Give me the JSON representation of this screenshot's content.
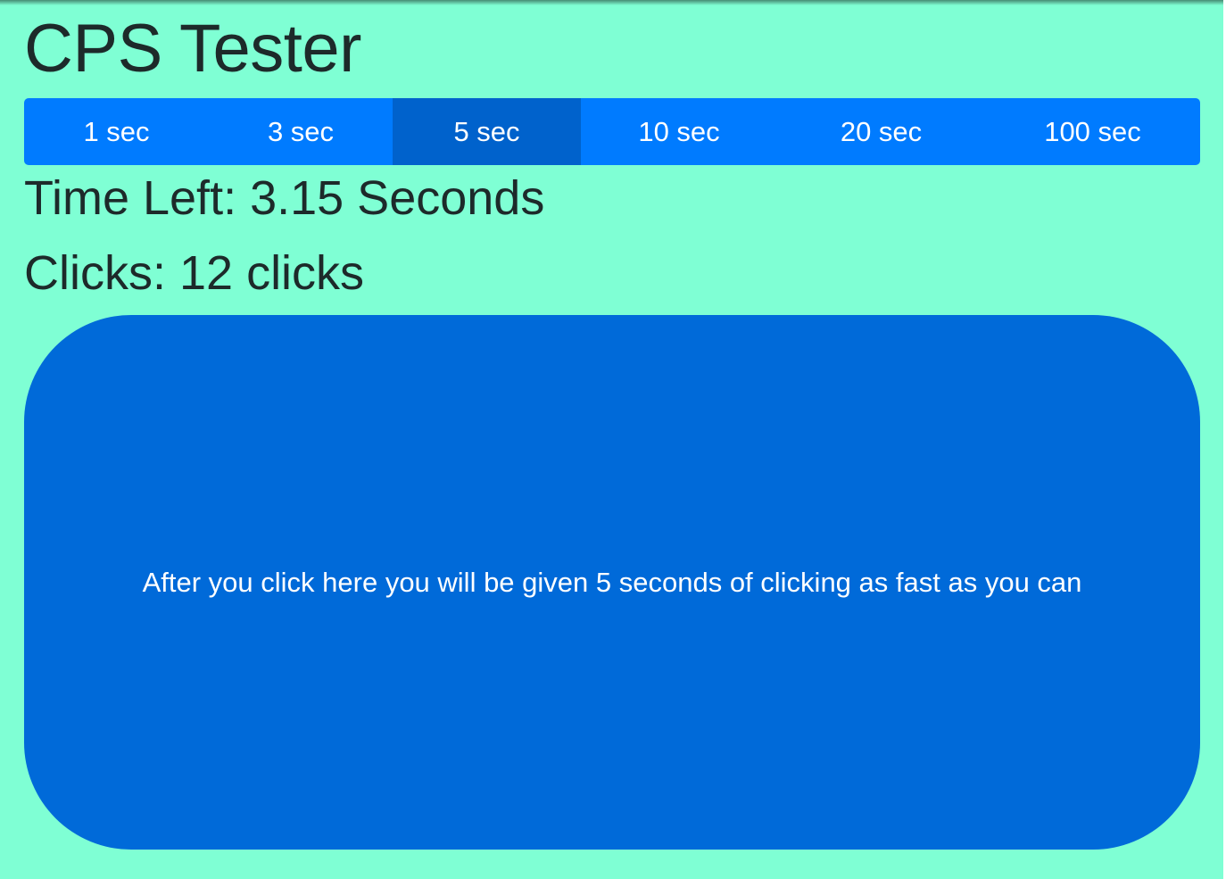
{
  "header": {
    "title": "CPS Tester"
  },
  "duration_selector": {
    "options": [
      {
        "label": "1 sec",
        "active": false
      },
      {
        "label": "3 sec",
        "active": false
      },
      {
        "label": "5 sec",
        "active": true
      },
      {
        "label": "10 sec",
        "active": false
      },
      {
        "label": "20 sec",
        "active": false
      },
      {
        "label": "100 sec",
        "active": false
      }
    ]
  },
  "stats": {
    "time_left": "Time Left: 3.15 Seconds",
    "clicks": "Clicks: 12 clicks"
  },
  "click_area": {
    "instruction": "After you click here you will be given 5 seconds of clicking as fast as you can"
  },
  "colors": {
    "background": "#7fffd4",
    "button_bar": "#007bff",
    "button_active": "#0062cc",
    "click_area": "#006ad9",
    "text": "#1d2a2a"
  }
}
